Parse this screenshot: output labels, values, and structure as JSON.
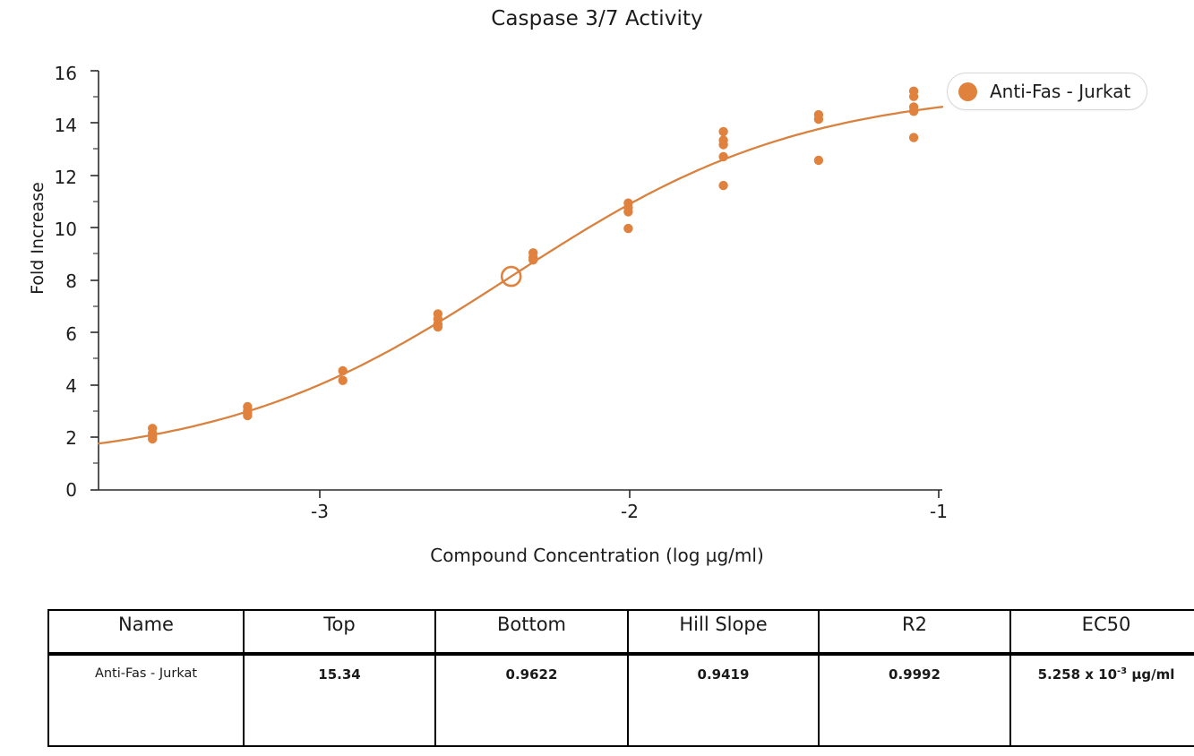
{
  "chart_data": {
    "type": "scatter",
    "title": "Caspase 3/7 Activity",
    "xlabel": "Compound Concentration (log µg/ml)",
    "ylabel": "Fold Increase",
    "xlim": [
      -3.58,
      -0.92
    ],
    "ylim": [
      0,
      16
    ],
    "xticks": [
      -3,
      -2,
      -1
    ],
    "xtick_labels": [
      "-3",
      "-2",
      "-1"
    ],
    "yticks": [
      0,
      2,
      4,
      6,
      8,
      10,
      12,
      14,
      16
    ],
    "ytick_labels": [
      "0",
      "2",
      "4",
      "6",
      "8",
      "10",
      "12",
      "14",
      "16"
    ],
    "yminorticks": [
      1,
      3,
      5,
      7,
      9,
      11,
      13,
      15
    ],
    "grid": false,
    "legend_position": "top-right",
    "series": [
      {
        "name": "Anti-Fas - Jurkat",
        "color": "#E0823E",
        "marker": "circle",
        "points": [
          {
            "x": -3.41,
            "y": 2.35
          },
          {
            "x": -3.41,
            "y": 2.16
          },
          {
            "x": -3.41,
            "y": 2.05
          },
          {
            "x": -3.41,
            "y": 1.95
          },
          {
            "x": -3.11,
            "y": 3.18
          },
          {
            "x": -3.11,
            "y": 3.02
          },
          {
            "x": -3.11,
            "y": 2.92
          },
          {
            "x": -3.11,
            "y": 2.84
          },
          {
            "x": -2.81,
            "y": 4.55
          },
          {
            "x": -2.81,
            "y": 4.18
          },
          {
            "x": -2.51,
            "y": 6.72
          },
          {
            "x": -2.51,
            "y": 6.52
          },
          {
            "x": -2.51,
            "y": 6.33
          },
          {
            "x": -2.51,
            "y": 6.22
          },
          {
            "x": -2.21,
            "y": 9.05
          },
          {
            "x": -2.21,
            "y": 8.88
          },
          {
            "x": -2.21,
            "y": 8.78
          },
          {
            "x": -1.91,
            "y": 10.95
          },
          {
            "x": -1.91,
            "y": 10.78
          },
          {
            "x": -1.91,
            "y": 10.62
          },
          {
            "x": -1.91,
            "y": 9.98
          },
          {
            "x": -1.61,
            "y": 13.68
          },
          {
            "x": -1.61,
            "y": 13.35
          },
          {
            "x": -1.61,
            "y": 13.18
          },
          {
            "x": -1.61,
            "y": 12.72
          },
          {
            "x": -1.61,
            "y": 11.62
          },
          {
            "x": -1.31,
            "y": 14.32
          },
          {
            "x": -1.31,
            "y": 14.15
          },
          {
            "x": -1.31,
            "y": 12.58
          },
          {
            "x": -1.01,
            "y": 15.22
          },
          {
            "x": -1.01,
            "y": 15.02
          },
          {
            "x": -1.01,
            "y": 14.62
          },
          {
            "x": -1.01,
            "y": 14.45
          },
          {
            "x": -1.01,
            "y": 13.45
          }
        ],
        "fit_curve": {
          "top": 15.34,
          "bottom": 0.9622,
          "hill_slope": 0.9419,
          "logEC50": -2.279
        },
        "ec50_marker": {
          "x": -2.279,
          "y": 8.15,
          "style": "open-circle"
        }
      }
    ]
  },
  "legend": {
    "entries": [
      {
        "label": "Anti-Fas - Jurkat",
        "color": "#E0823E",
        "marker": "dot"
      }
    ]
  },
  "results_table": {
    "headers": [
      "Name",
      "Top",
      "Bottom",
      "Hill Slope",
      "R2",
      "EC50"
    ],
    "rows": [
      {
        "name": "Anti-Fas - Jurkat",
        "top": "15.34",
        "bottom": "0.9622",
        "hill_slope": "0.9419",
        "r2": "0.9992",
        "ec50_mantissa": "5.258 x 10",
        "ec50_exponent": "-3",
        "ec50_units": "µg/ml"
      }
    ]
  }
}
